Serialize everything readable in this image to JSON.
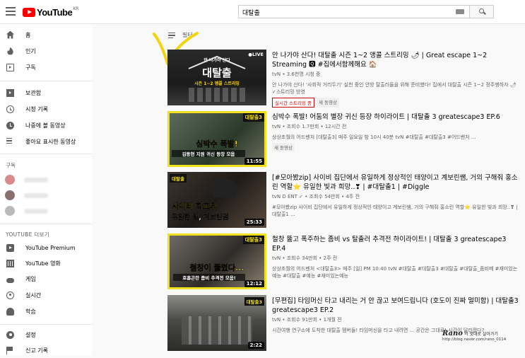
{
  "header": {
    "logo_text": "YouTube",
    "logo_region": "KR",
    "search_value": "대탈출"
  },
  "sidebar": {
    "items_top": [
      {
        "label": "홈",
        "icon": "home-icon"
      },
      {
        "label": "인기",
        "icon": "trending-icon"
      },
      {
        "label": "구독",
        "icon": "subscriptions-icon"
      }
    ],
    "items_library": [
      {
        "label": "보관함",
        "icon": "library-icon"
      },
      {
        "label": "시청 기록",
        "icon": "history-icon"
      },
      {
        "label": "나중에 볼 동영상",
        "icon": "watch-later-icon"
      },
      {
        "label": "좋아요 표시한 동영상",
        "icon": "liked-icon"
      }
    ],
    "subscriptions_header": "구독",
    "more_header": "YOUTUBE 더보기",
    "items_more": [
      {
        "label": "YouTube Premium",
        "icon": "premium-icon"
      },
      {
        "label": "YouTube 영화",
        "icon": "movies-icon"
      },
      {
        "label": "게임",
        "icon": "gaming-icon"
      },
      {
        "label": "실시간",
        "icon": "live-icon"
      },
      {
        "label": "학습",
        "icon": "learning-icon"
      }
    ],
    "items_bottom": [
      {
        "label": "설정",
        "icon": "settings-icon"
      },
      {
        "label": "신고 기록",
        "icon": "flag-icon"
      }
    ]
  },
  "filter_label": "필터",
  "videos": [
    {
      "title": "안 나가야 산다! 대탈출 시즌 1~2 앵콜 스트리밍 🌶 | Great escape 1~2 Streaming 🆀 #집에서함께해요 🏠",
      "meta": "tvN • 3.6천명 시청 중",
      "desc": "안 나가야 산다! '사회적 거리두기' 실천 중인 안방 탈출러들을 위해 준비했다! 집에서 대탈출 시즌 1~2 정주행하자 🌶 ✓스트리밍 방영",
      "badges": [
        "실시간 스트리밍 중",
        "새 동영상"
      ],
      "duration": "",
      "live_label": "●LIVE",
      "thumb_caption": "대탈출",
      "thumb_top": "안 나가야 산다",
      "thumb_sub": "시즌 1~2 앵콜 스트리밍"
    },
    {
      "title": "심박수 폭발! 어둠의 별장 귀신 등장 하이라이트 | 대탈출 3 greatescape3 EP.6",
      "meta": "tvN • 조회수 1.7만회 • 12시간 전",
      "desc": "상상초월의 어드벤처 [대탈출3] 매주 일요일 밤 10시 40분 tvN #대탈출 #대탈출3 #어드벤처 ...",
      "badges": [
        "새 동영상"
      ],
      "duration": "11:55",
      "live_label": "",
      "thumb_caption": "심박수 폭발!",
      "thumb_top": "대탈출3",
      "thumb_sub": "김동현 지원 귀신 등장 모음"
    },
    {
      "title": "[#모아봤zip] 사이비 집단에서 유일하게 정상적인 태양이고 계보린쌤, 거의 구해줘 홍소린 역할⭐ 유일한 빛과 희망..❣ | #대탈출1 | #Diggle",
      "meta": "tvN D ENT ✓ • 조회수 54만회 • 4주 전",
      "desc": "#모아봤zip 사이비 집단에서 유일하게 정상적인 태양이고 계보린쌤, 거의 구해줘 홍소린 역할⭐ 유일한 빛과 희망..❣ | 대탈출1 ...",
      "badges": [],
      "duration": "25:33",
      "live_label": "",
      "thumb_caption": "사이비 학교의",
      "thumb_top": "대탈출",
      "thumb_sub": "유일한 빛, 계보린쌤"
    },
    {
      "title": "철창 뚫고 폭주하는 좀비 vs 탈출러 추격전 하이라이트! | 대탈출 3 greatescape3 EP.4",
      "meta": "tvN • 조회수 34만회 • 2주 전",
      "desc": "상상초월의 어드벤처 <대탈출3> 매주 [일] PM 10:40 tvN #대탈출 #대탈출3 #대탈출 #대탈출_좀비떼 #재미있는예능 #대탈출 #예능 #재미있는예능",
      "badges": [],
      "duration": "12:12",
      "live_label": "",
      "thumb_caption": "철창이 뚫렸다...",
      "thumb_top": "대탈출3",
      "thumb_sub": "호흡곤란 좀비 추격전 모음!"
    },
    {
      "title": "[무편집] 타임머신 타고 내리는 거 안 끊고 보여드립니다 (호도이 진짜 멀미함) | 대탈출3 greatescape3 EP.2",
      "meta": "tvN • 조회수 91만회 • 1개월 전",
      "desc": "시간여행 연구소에 도착한 대탈출 멤버들! 타임머신을 타고 내려면 ... 공간은 그대로! 시간이 달라졌다?",
      "badges": [],
      "duration": "2:22",
      "live_label": "",
      "thumb_caption": "",
      "thumb_top": "대탈출3",
      "thumb_sub": ""
    }
  ],
  "watermark": {
    "name": "Rano",
    "subtitle": "의 멋대로 살아가기",
    "url": "http://blog.naver.com/rano_0114"
  },
  "colors": {
    "brand_red": "#ff0000",
    "annotation_yellow": "#f2d40c",
    "live_red": "#cc0000"
  }
}
